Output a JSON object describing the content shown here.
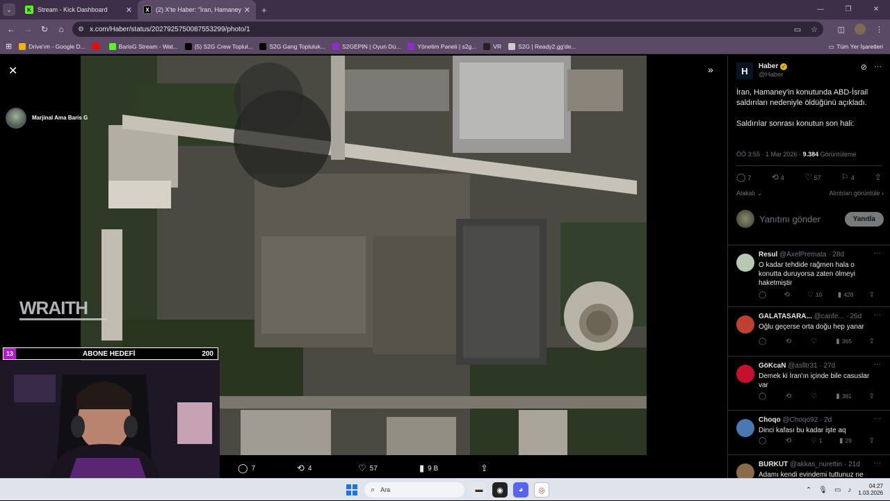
{
  "browser": {
    "tabs": [
      {
        "title": "Stream - Kick Dashboard",
        "favicon": "K",
        "kind": "kick",
        "active": false
      },
      {
        "title": "(2) X'te Haber: \"İran, Hamaney'",
        "favicon": "X",
        "kind": "x",
        "active": true
      }
    ],
    "url": "x.com/Haber/status/2027925750087553299/photo/1",
    "bookmarks": [
      {
        "label": "Drive'ım - Google D...",
        "icon": "drive-icon",
        "color": "#f4b400"
      },
      {
        "label": "",
        "icon": "youtube-icon",
        "color": "#ff0000"
      },
      {
        "label": "BarisG Stream - Wat...",
        "icon": "kick-icon",
        "color": "#53fc18"
      },
      {
        "label": "(5) S2G Crew Topluł...",
        "icon": "x-icon",
        "color": "#000000"
      },
      {
        "label": "S2G Gang Topluluk...",
        "icon": "x-icon",
        "color": "#000000"
      },
      {
        "label": "S2GEPIN | Oyun Dü...",
        "icon": "s2g-icon",
        "color": "#8e2ad6"
      },
      {
        "label": "Yönetim Paneli | s2g...",
        "icon": "s2g-icon",
        "color": "#8e2ad6"
      },
      {
        "label": "VR",
        "icon": "vr-icon",
        "color": "#222222"
      },
      {
        "label": "S2G | Ready2.gg'de...",
        "icon": "globe-icon",
        "color": "#cccccc"
      }
    ],
    "bookmarks_all": "Tüm Yer İşaretleri"
  },
  "photo_actions": {
    "replies": "7",
    "reposts": "4",
    "likes": "57",
    "views": "9 B"
  },
  "stream": {
    "streamer_name": "Marjinal Ama Baris G",
    "watermark": "WRAITH",
    "goal_current": "13",
    "goal_label": "ABONE HEDEFİ",
    "goal_target": "200"
  },
  "tweet": {
    "author": "Haber",
    "logo": "H",
    "handle": "@Haber",
    "text1": "İran, Hamaney'in konutunda ABD-İsrail saldırıları nedeniyle öldüğünü açıkladı.",
    "text2": "Saldırılar sonrası konutun son hali:",
    "time": "ÖÖ 3:55 · 1 Mar 2026 ·",
    "views": "9.384",
    "views_label": "Görüntüleme",
    "replies": "7",
    "reposts": "4",
    "likes": "57",
    "bookmarks": "4",
    "relevant": "Alakalı",
    "quotes": "Alıntıları görüntüle",
    "reply_placeholder": "Yanıtını gönder",
    "reply_button": "Yanıtla"
  },
  "replies": [
    {
      "name": "Resul",
      "handle": "@AxelPremata · 28d",
      "text": "O kadar tehdide rağmen hala o konutta duruyorsa zaten ölmeyi haketmiştir",
      "likes": "10",
      "views": "428",
      "avatar_color": "#b7c9b0"
    },
    {
      "name": "GALATASARA...",
      "handle": "@canfe... · 26d",
      "text": "Oğlu geçerse orta doğu hep yanar",
      "likes": "",
      "views": "365",
      "avatar_color": "#c04030"
    },
    {
      "name": "GöKcaN",
      "handle": "@aslltr31 · 27d",
      "text": "Demek ki İran'ın içinde bile casuslar var",
      "likes": "",
      "views": "381",
      "avatar_color": "#c8102e"
    },
    {
      "name": "Choqo",
      "handle": "@Choqo92 · 2d",
      "text": "Dinci kafası bu kadar işte aq",
      "likes": "1",
      "views": "29",
      "avatar_color": "#4a78b0"
    },
    {
      "name": "BÜRKÜT",
      "handle": "@akkas_nurettin · 21d",
      "text": "Adamı kendi evindemi tuttunuz ne",
      "likes": "",
      "views": "",
      "avatar_color": "#8a6a4a"
    }
  ],
  "taskbar": {
    "search": "Ara",
    "time": "04:27",
    "date": "1.03.2026"
  }
}
